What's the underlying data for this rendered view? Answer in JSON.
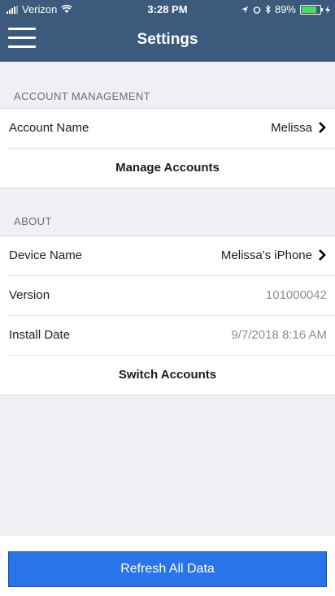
{
  "status_bar": {
    "carrier": "Verizon",
    "time": "3:28 PM",
    "battery_text": "89%",
    "battery_level": 0.89,
    "battery_color": "#4cd964"
  },
  "nav": {
    "title": "Settings",
    "menu_icon": "hamburger-menu-icon",
    "bar_color": "#3b5a7c"
  },
  "account_management": {
    "header": "ACCOUNT MANAGEMENT",
    "account_name_label": "Account Name",
    "account_name_value": "Melissa",
    "manage_accounts": "Manage Accounts"
  },
  "about": {
    "header": "ABOUT",
    "device_name_label": "Device Name",
    "device_name_value": "Melissa's iPhone",
    "version_label": "Version",
    "version_value": "101000042",
    "install_date_label": "Install Date",
    "install_date_value": "9/7/2018 8:16 AM",
    "switch_accounts": "Switch Accounts"
  },
  "footer": {
    "refresh_label": "Refresh All Data",
    "button_color": "#2a73e8"
  }
}
